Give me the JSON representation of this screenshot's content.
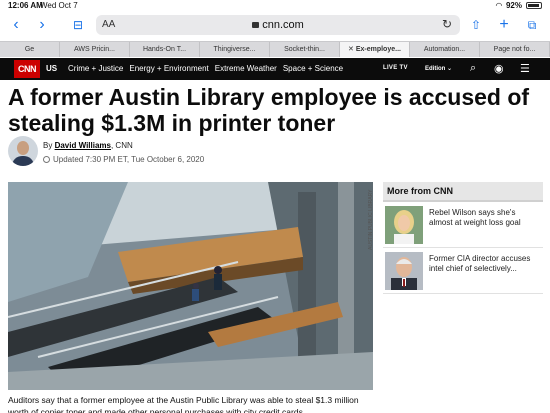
{
  "status": {
    "time": "12:06 AM",
    "date": "Wed Oct 7",
    "battery": "92%"
  },
  "browser": {
    "text_size": "AA",
    "host": "cnn.com",
    "tabs": [
      "Ge",
      "AWS Pricin...",
      "Hands-On T...",
      "Thingiverse...",
      "Socket-thin...",
      "Ex-employe...",
      "Automation...",
      "Page not fo..."
    ],
    "active_tab": 5
  },
  "cnn_nav": {
    "logo": "CNN",
    "edition": "US",
    "links": [
      "Crime + Justice",
      "Energy + Environment",
      "Extreme Weather",
      "Space + Science"
    ],
    "live_tv": "LIVE TV",
    "edition_select": "Edition"
  },
  "article": {
    "headline": "A former Austin Library employee is accused of stealing $1.3M in printer toner",
    "by_prefix": "By",
    "author": "David Williams",
    "outlet": ", CNN",
    "updated": "Updated 7:30 PM ET, Tue October 6, 2020",
    "photo_credit": "AUSTIN PUBLIC LIBRARY",
    "body": "Auditors say that a former employee at the Austin Public Library was able to steal $1.3 million worth of copier toner and made other personal purchases with city credit cards."
  },
  "sidebar": {
    "title": "More from CNN",
    "stories": [
      {
        "text": "Rebel Wilson says she's almost at weight loss goal"
      },
      {
        "text": "Former CIA director accuses intel chief of selectively..."
      }
    ]
  },
  "colors": {
    "cnn_red": "#cc0000",
    "nav_bg": "#0c0c0c",
    "link_blue": "#1a73e8"
  }
}
